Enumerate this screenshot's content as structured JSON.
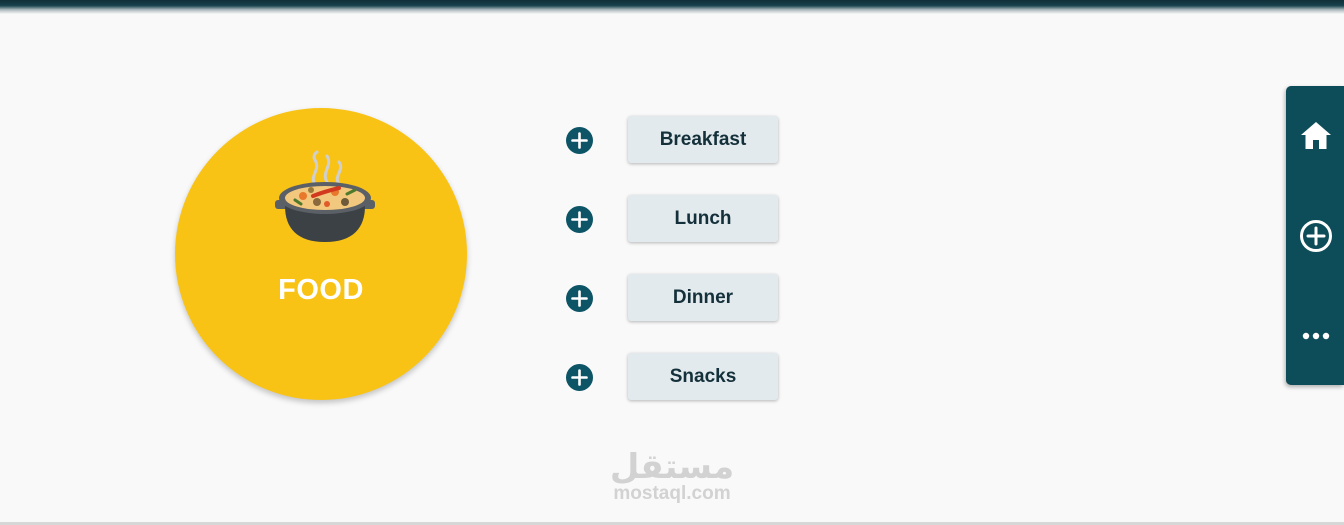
{
  "food_card": {
    "label": "FOOD",
    "icon": "cooking-pot-icon",
    "color": "#f9c316"
  },
  "meals": [
    {
      "label": "Breakfast"
    },
    {
      "label": "Lunch"
    },
    {
      "label": "Dinner"
    },
    {
      "label": "Snacks"
    }
  ],
  "side_nav": {
    "items": [
      {
        "icon": "home-icon"
      },
      {
        "icon": "add-circle-icon"
      },
      {
        "icon": "more-horizontal-icon"
      }
    ],
    "color": "#0d4d5a"
  },
  "watermark": {
    "arabic": "مستقل",
    "latin": "mostaql.com"
  },
  "colors": {
    "accent": "#0d5566",
    "button_bg": "#e3eaee",
    "page_bg": "#f9f9f9"
  }
}
